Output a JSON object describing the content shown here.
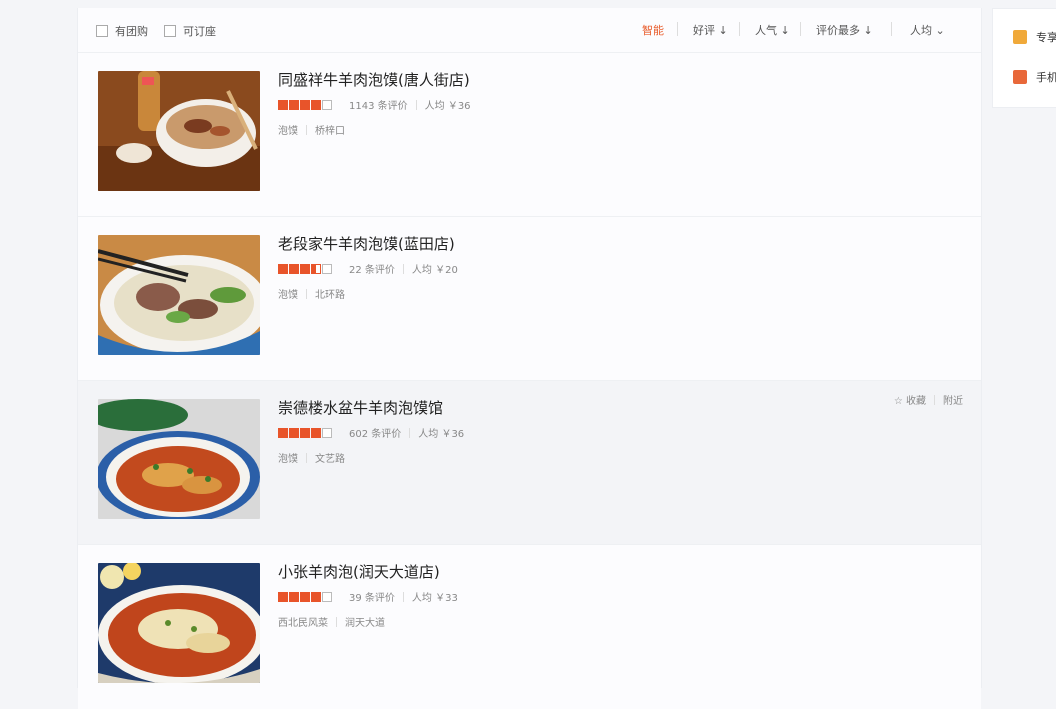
{
  "filters": {
    "checkbox_1": "有团购",
    "checkbox_2": "可订座",
    "sort_smart": "智能",
    "sort_rating": "好评",
    "sort_popularity": "人气",
    "sort_reviews": "评价最多",
    "sort_price": "人均"
  },
  "restaurants": [
    {
      "name": "同盛祥牛羊肉泡馍(唐人街店)",
      "reviews": "1143 条评价",
      "avg_price": "人均 ￥36",
      "tag_1": "泡馍",
      "tag_2": "桥梓口",
      "rating": 4
    },
    {
      "name": "老段家牛羊肉泡馍(蓝田店)",
      "reviews": "22 条评价",
      "avg_price": "人均 ￥20",
      "tag_1": "泡馍",
      "tag_2": "北环路",
      "rating": 3.5
    },
    {
      "name": "崇德楼水盆牛羊肉泡馍馆",
      "reviews": "602 条评价",
      "avg_price": "人均 ￥36",
      "tag_1": "泡馍",
      "tag_2": "文艺路",
      "rating": 4,
      "fav_label": "收藏",
      "nearby_label": "附近"
    },
    {
      "name": "小张羊肉泡(润天大道店)",
      "reviews": "39 条评价",
      "avg_price": "人均 ￥33",
      "tag_1": "西北民风菜",
      "tag_2": "润天大道",
      "rating": 4
    }
  ],
  "side": {
    "item_1": "专享",
    "item_2": "手机"
  },
  "colors": {
    "accent": "#e85c2b",
    "star": "#e8542a"
  }
}
